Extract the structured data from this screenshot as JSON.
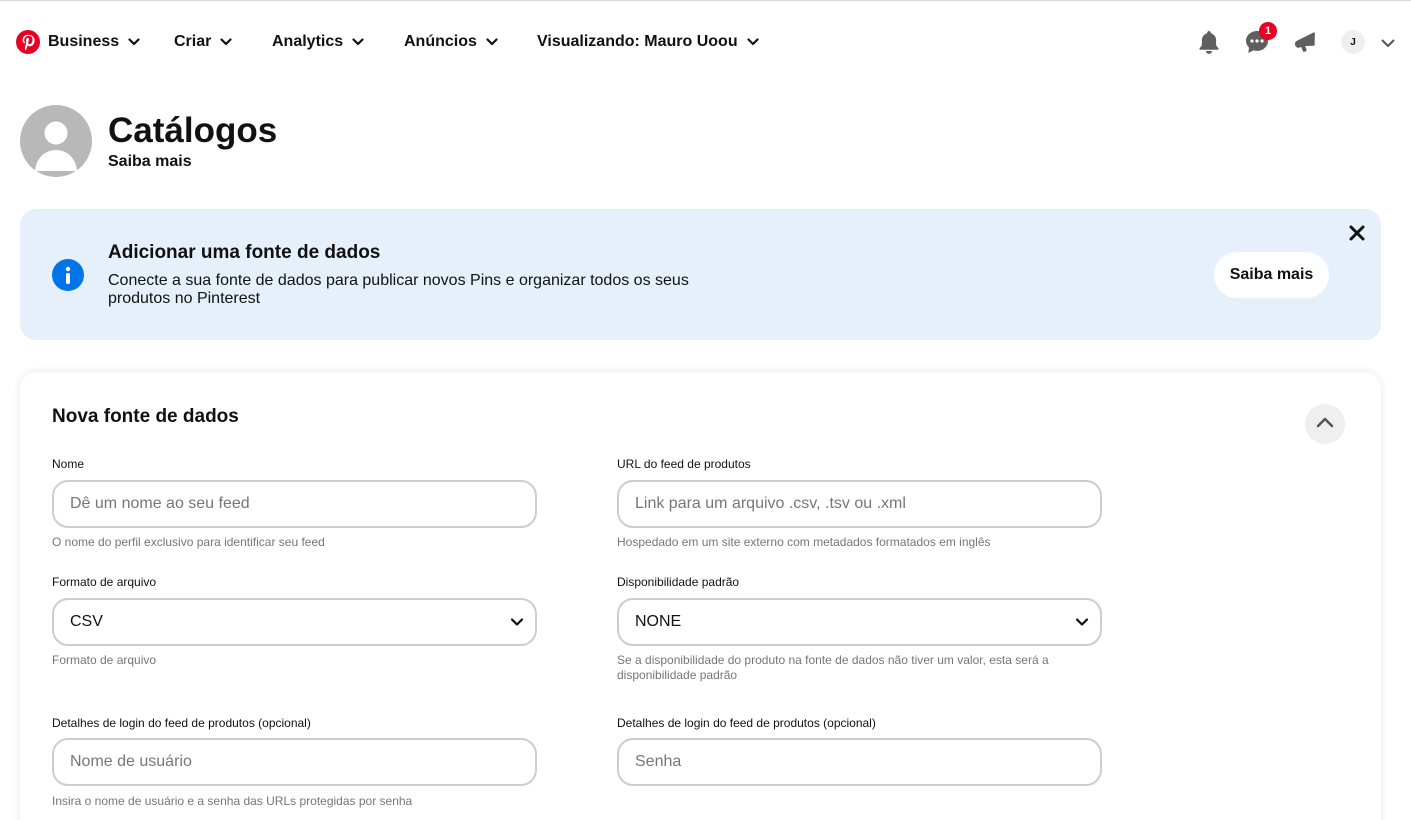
{
  "topnav": {
    "logo_icon": "pinterest-logo",
    "items": [
      {
        "label": "Business"
      },
      {
        "label": "Criar"
      },
      {
        "label": "Analytics"
      },
      {
        "label": "Anúncios"
      },
      {
        "label": "Visualizando: Mauro Uoou"
      }
    ],
    "notifications_icon": "bell-icon",
    "messages_icon": "chat-icon",
    "messages_badge": "1",
    "updates_icon": "megaphone-icon",
    "user_initial": "J"
  },
  "header": {
    "title": "Catálogos",
    "learn_more": "Saiba mais"
  },
  "banner": {
    "title": "Adicionar uma fonte de dados",
    "text": "Conecte a sua fonte de dados para publicar novos Pins e organizar todos os seus produtos no Pinterest",
    "button_label": "Saiba mais",
    "accent_color": "#0074e8",
    "background_color": "#e6f0fb"
  },
  "form": {
    "title": "Nova fonte de dados",
    "name": {
      "label": "Nome",
      "placeholder": "Dê um nome ao seu feed",
      "help": "O nome do perfil exclusivo para identificar seu feed"
    },
    "url": {
      "label": "URL do feed de produtos",
      "placeholder": "Link para um arquivo .csv, .tsv ou .xml",
      "help": "Hospedado em um site externo com metadados formatados em inglês"
    },
    "format": {
      "label": "Formato de arquivo",
      "value": "CSV",
      "help": "Formato de arquivo"
    },
    "availability": {
      "label": "Disponibilidade padrão",
      "value": "NONE",
      "help": "Se a disponibilidade do produto na fonte de dados não tiver um valor, esta será a disponibilidade padrão"
    },
    "login_user": {
      "label": "Detalhes de login do feed de produtos (opcional)",
      "placeholder": "Nome de usuário",
      "help": "Insira o nome de usuário e a senha das URLs protegidas por senha"
    },
    "login_pass": {
      "label": "Detalhes de login do feed de produtos (opcional)",
      "placeholder": "Senha"
    }
  },
  "colors": {
    "brand": "#e60023",
    "border": "#cdcdcd",
    "muted_text": "#767676"
  }
}
